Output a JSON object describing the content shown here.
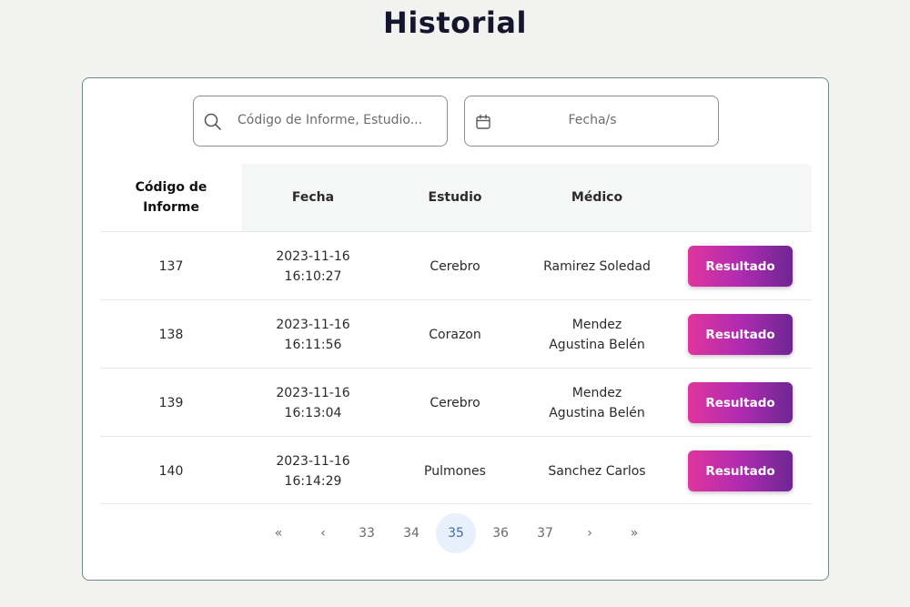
{
  "page": {
    "title": "Historial"
  },
  "filters": {
    "search_placeholder": "Código de Informe, Estudio...",
    "date_placeholder": "Fecha/s"
  },
  "table": {
    "headers": {
      "code": "Código de\nInforme",
      "fecha": "Fecha",
      "estudio": "Estudio",
      "medico": "Médico"
    },
    "rows": [
      {
        "code": "137",
        "fecha": "2023-11-16\n16:10:27",
        "estudio": "Cerebro",
        "medico": "Ramirez Soledad",
        "action": "Resultado"
      },
      {
        "code": "138",
        "fecha": "2023-11-16\n16:11:56",
        "estudio": "Corazon",
        "medico": "Mendez\nAgustina Belén",
        "action": "Resultado"
      },
      {
        "code": "139",
        "fecha": "2023-11-16\n16:13:04",
        "estudio": "Cerebro",
        "medico": "Mendez\nAgustina Belén",
        "action": "Resultado"
      },
      {
        "code": "140",
        "fecha": "2023-11-16\n16:14:29",
        "estudio": "Pulmones",
        "medico": "Sanchez Carlos",
        "action": "Resultado"
      }
    ]
  },
  "pagination": {
    "first": "«",
    "prev": "‹",
    "pages": [
      "33",
      "34",
      "35",
      "36",
      "37"
    ],
    "current": "35",
    "next": "›",
    "last": "»"
  },
  "colors": {
    "accent_start": "#e0359d",
    "accent_end": "#6e2693",
    "card_border": "#6f8a80",
    "active_page_bg": "#e8f1fb"
  },
  "icons": {
    "search": "search-icon",
    "date": "calendar-icon"
  }
}
